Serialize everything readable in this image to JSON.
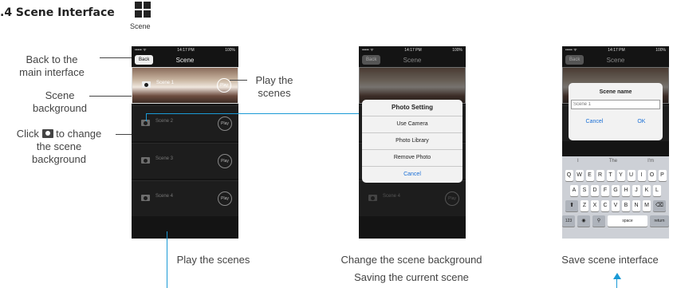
{
  "heading": ".4 Scene Interface",
  "scene_icon_label": "Scene",
  "annotations": {
    "back": [
      "Back to the",
      "main interface"
    ],
    "scene_bg": [
      "Scene",
      "background"
    ],
    "click_prefix": "Click",
    "click_suffix": "to change",
    "click_rest": [
      "the scene",
      "background"
    ],
    "play": [
      "Play the",
      "scenes"
    ]
  },
  "captions": {
    "c1": "Play the scenes",
    "c2a": "Change the scene background",
    "c2b": "Saving the current scene",
    "c3": "Save scene interface"
  },
  "phone": {
    "carrier": "••••• ᯤ",
    "time": "14:17 PM",
    "battery": "100%",
    "nav_title": "Scene",
    "back_label": "Back",
    "scenes": [
      "Scene 1",
      "Scene 2",
      "Scene 3",
      "Scene 4"
    ],
    "play_label": "Play"
  },
  "photo_setting": {
    "title": "Photo Setting",
    "options": [
      "Use Camera",
      "Photo Library",
      "Remove Photo"
    ],
    "cancel": "Cancel"
  },
  "name_dialog": {
    "title": "Scene name",
    "placeholder": "Scene 1",
    "cancel": "Cancel",
    "ok": "OK"
  },
  "keyboard": {
    "suggestions": [
      "I",
      "The",
      "I'm"
    ],
    "row1": [
      "Q",
      "W",
      "E",
      "R",
      "T",
      "Y",
      "U",
      "I",
      "O",
      "P"
    ],
    "row2": [
      "A",
      "S",
      "D",
      "F",
      "G",
      "H",
      "J",
      "K",
      "L"
    ],
    "row3": [
      "Z",
      "X",
      "C",
      "V",
      "B",
      "N",
      "M"
    ],
    "num": "123",
    "space": "space",
    "return": "return"
  },
  "colors": {
    "accent_line": "#1a9ad6",
    "phone_bg": "#141414"
  }
}
